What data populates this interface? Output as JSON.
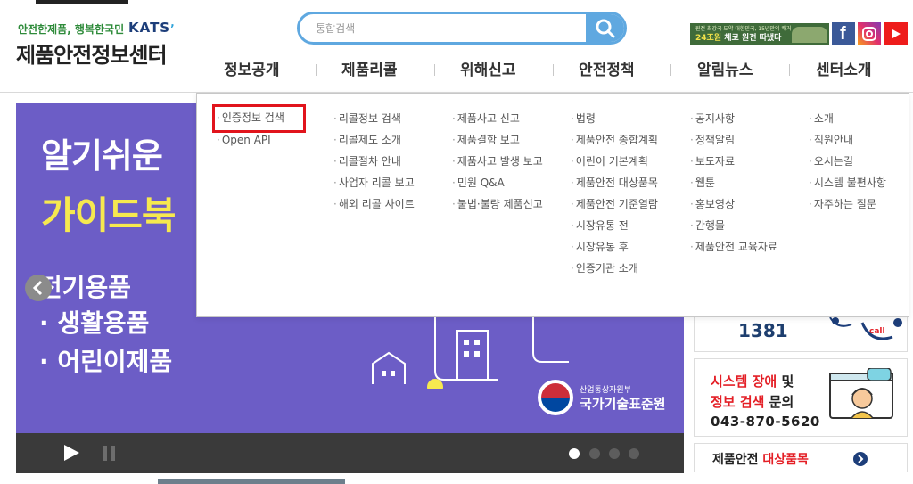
{
  "header": {
    "slogan": "안전한제품, 행복한국민",
    "kats_logo": "KATS",
    "site_title": "제품안전정보센터",
    "search": {
      "placeholder": "통합검색"
    },
    "banner": {
      "line1": "원전 최강국 도약 대한민국, 15년만의 쾌거",
      "line2_prefix": "24조원",
      "line2_rest": " 체코 원전 따냈다"
    },
    "sns": [
      "facebook-icon",
      "instagram-icon",
      "youtube-icon"
    ]
  },
  "gnb": [
    {
      "label": "정보공개"
    },
    {
      "label": "제품리콜"
    },
    {
      "label": "위해신고"
    },
    {
      "label": "안전정책"
    },
    {
      "label": "알림뉴스"
    },
    {
      "label": "센터소개"
    }
  ],
  "mega_menu": {
    "columns": [
      [
        "인증정보 검색",
        "Open API"
      ],
      [
        "리콜정보 검색",
        "리콜제도 소개",
        "리콜절차 안내",
        "사업자 리콜 보고",
        "해외 리콜 사이트"
      ],
      [
        "제품사고 신고",
        "제품결함 보고",
        "제품사고 발생 보고",
        "민원 Q&A",
        "불법·불량 제품신고"
      ],
      [
        "법령",
        "제품안전 종합계획",
        "어린이 기본계획",
        "제품안전 대상품목",
        "제품안전 기준열람",
        "시장유통 전",
        "시장유통 후",
        "인증기관 소개"
      ],
      [
        "공지사항",
        "정책알림",
        "보도자료",
        "웹툰",
        "홍보영상",
        "간행물",
        "제품안전 교육자료"
      ],
      [
        "소개",
        "직원안내",
        "오시는길",
        "시스템 불편사항",
        "자주하는 질문"
      ]
    ],
    "bullet": "·",
    "highlighted": "인증정보 검색",
    "highlight_color": "#e1141c"
  },
  "slide": {
    "title1": "알기쉬운",
    "title2": "가이드북",
    "bullets": [
      "전기용품",
      "· 생활용품",
      "· 어린이제품"
    ],
    "org_small": "산업통상자원부",
    "org_big": "국가기술표준원",
    "bg_color": "#6c5dc6",
    "accent_color": "#f6e94f",
    "dots": {
      "count": 4,
      "active": 1
    }
  },
  "right": {
    "call_number": "1381",
    "error_line1_red": "시스템 장애",
    "error_line1_rest": " 및",
    "error_line2_red": "정보 검색",
    "error_line2_rest": " 문의",
    "error_phone": "043-870-5620",
    "target_prefix": "제품안전 ",
    "target_red": "대상품목"
  }
}
